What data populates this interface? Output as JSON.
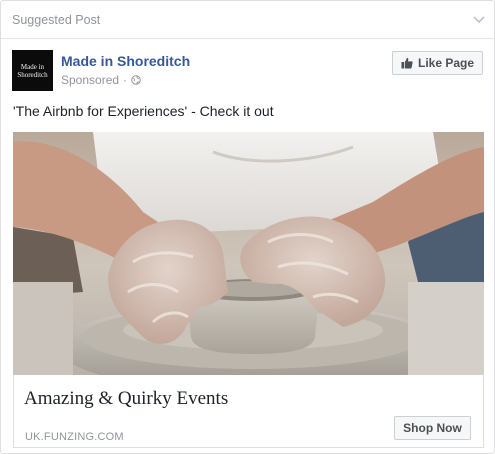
{
  "header": {
    "label": "Suggested Post",
    "menu_icon": "chevron-down-icon"
  },
  "page": {
    "logo_text_line1": "Made in",
    "logo_text_line2": "Shoreditch",
    "name": "Made in Shoreditch",
    "sponsored": "Sponsored",
    "separator": "·",
    "audience_icon": "globe-icon"
  },
  "actions": {
    "like_label": "Like Page",
    "like_icon": "thumbs-up-icon"
  },
  "post": {
    "text": "'The Airbnb for Experiences' - Check it out"
  },
  "link": {
    "headline": "Amazing & Quirky Events",
    "domain": "UK.FUNZING.COM",
    "cta_label": "Shop Now"
  },
  "colors": {
    "link_blue": "#365899",
    "meta_grey": "#90949c",
    "button_bg": "#f6f7f9",
    "border": "#dddfe2"
  }
}
